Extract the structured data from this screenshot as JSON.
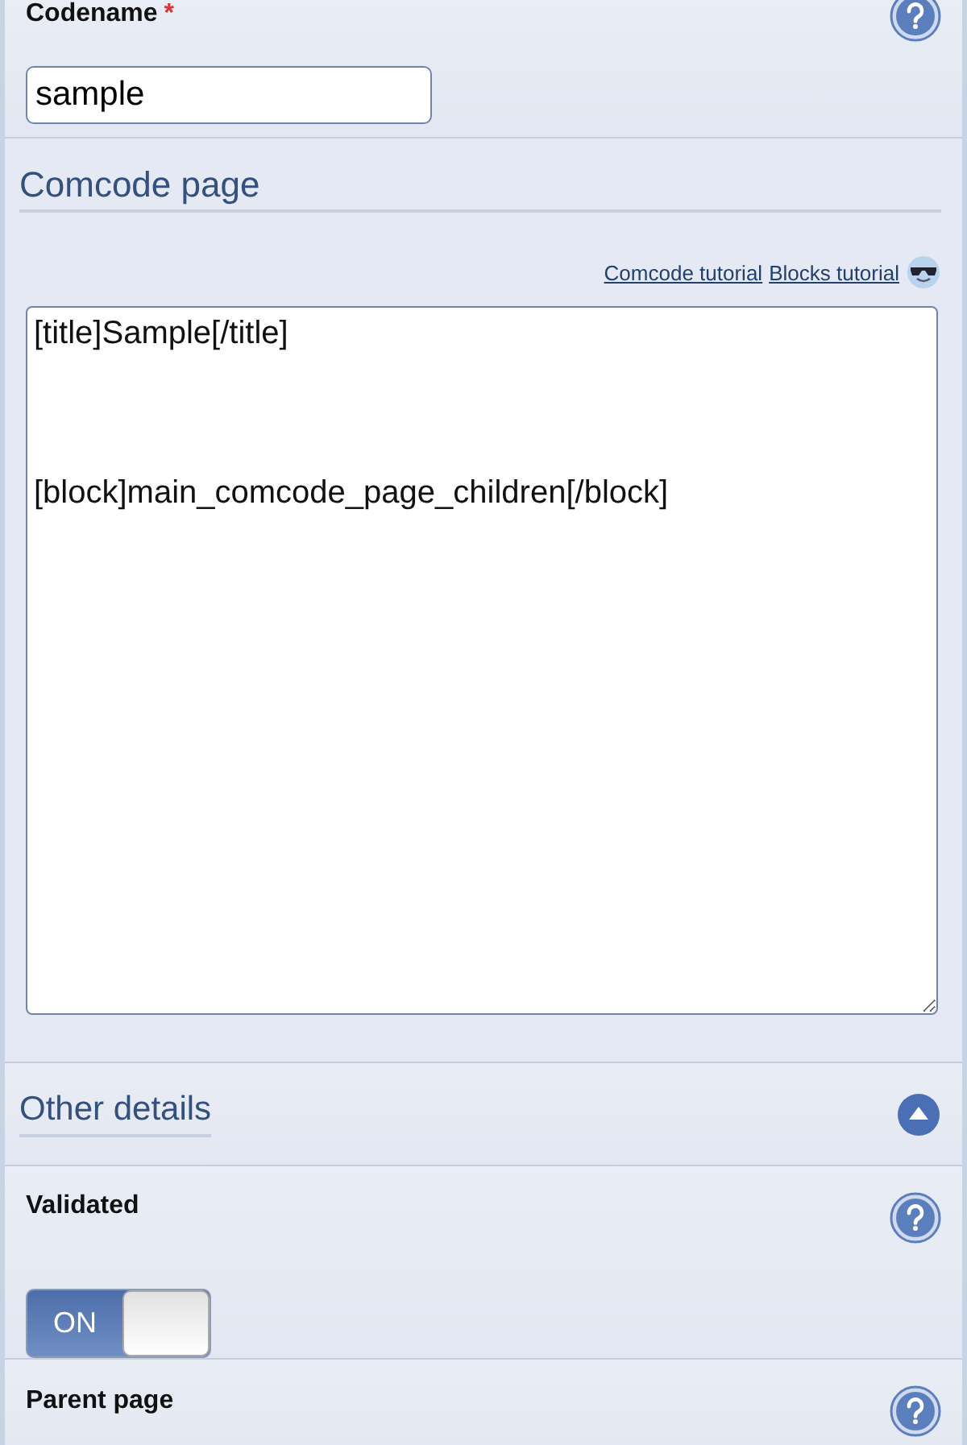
{
  "codename": {
    "label": "Codename",
    "required_mark": "*",
    "value": "sample"
  },
  "comcode_section": {
    "title": "Comcode page",
    "links": [
      "Comcode tutorial",
      "Blocks tutorial"
    ],
    "content": "[title]Sample[/title]\n\n\n[block]main_comcode_page_children[/block]"
  },
  "other_details": {
    "title": "Other details",
    "expanded": true
  },
  "validated": {
    "label": "Validated",
    "on": true,
    "toggle_text": "ON"
  },
  "parent_page": {
    "label": "Parent page"
  }
}
